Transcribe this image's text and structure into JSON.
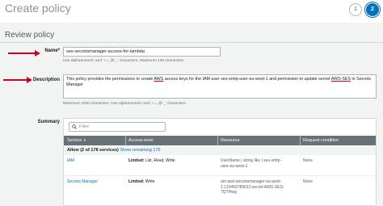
{
  "header": {
    "title": "Create policy",
    "steps": [
      "1",
      "2"
    ]
  },
  "section": {
    "title": "Review policy"
  },
  "name_field": {
    "label": "Name*",
    "value": "ses-secretsmanager-access-for-lambda",
    "hint": "Use alphanumeric and '+=,.@-_' characters. Maximum 128 characters."
  },
  "description_field": {
    "label": "Description",
    "text_a": "This policy provides the permissions to create ",
    "text_aws1": "AWS",
    "text_b": " access keys for the IAM user ses-smtp-user-eu-west-1 and permission to update secret ",
    "text_aws2": "AWS-SES",
    "text_c": " in Secrets Manager",
    "hint": "Maximum 1000 characters. Use alphanumeric and '+=,.@-_' characters."
  },
  "summary": {
    "label": "Summary",
    "filter_placeholder": "Filter",
    "columns": [
      "Service",
      "Access level",
      "Resource",
      "Request condition"
    ],
    "sort_indicator": "▼",
    "allow_text": "Allow (2 of 178 services)",
    "show_remaining": "Show remaining 176",
    "rows": [
      {
        "service": "IAM",
        "access_label": "Limited:",
        "access_value": " List, Read, Write",
        "resource_line1": "UserName | string like | ses-smtp-",
        "resource_line2": "user-eu-west-1",
        "condition": "None"
      },
      {
        "service": "Secrets Manager",
        "access_label": "Limited:",
        "access_value": " Write",
        "resource_line1": "arn:aws:secretsmanager:eu-west-",
        "resource_line2": "1:123456789012:secret:AWS-SES-",
        "resource_line3": "?QTHwg",
        "condition": "None"
      }
    ]
  },
  "colors": {
    "accent": "#0073bb",
    "annotation_arrow": "#d0021b",
    "table_header": "#687078"
  }
}
